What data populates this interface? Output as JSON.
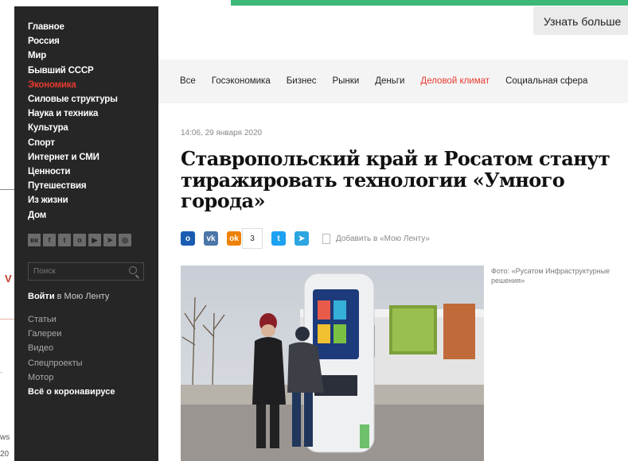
{
  "background_page": {
    "letter": "V",
    "text_bottom_1": "ws",
    "text_bottom_2": "20",
    "dot": "·"
  },
  "learn_more_button": "Узнать больше",
  "sidebar": {
    "nav": [
      {
        "label": "Главное",
        "active": false
      },
      {
        "label": "Россия",
        "active": false
      },
      {
        "label": "Мир",
        "active": false
      },
      {
        "label": "Бывший СССР",
        "active": false
      },
      {
        "label": "Экономика",
        "active": true
      },
      {
        "label": "Силовые структуры",
        "active": false
      },
      {
        "label": "Наука и техника",
        "active": false
      },
      {
        "label": "Культура",
        "active": false
      },
      {
        "label": "Спорт",
        "active": false
      },
      {
        "label": "Интернет и СМИ",
        "active": false
      },
      {
        "label": "Ценности",
        "active": false
      },
      {
        "label": "Путешествия",
        "active": false
      },
      {
        "label": "Из жизни",
        "active": false
      },
      {
        "label": "Дом",
        "active": false
      }
    ],
    "socials": [
      {
        "icon": "vk-icon",
        "glyph": "вк"
      },
      {
        "icon": "facebook-icon",
        "glyph": "f"
      },
      {
        "icon": "twitter-icon",
        "glyph": "t"
      },
      {
        "icon": "odnoklassniki-icon",
        "glyph": "о"
      },
      {
        "icon": "youtube-icon",
        "glyph": "▶"
      },
      {
        "icon": "telegram-icon",
        "glyph": "➤"
      },
      {
        "icon": "instagram-icon",
        "glyph": "◎"
      }
    ],
    "search_placeholder": "Поиск",
    "login_bold": "Войти",
    "login_rest": " в Мою Ленту",
    "sections": [
      {
        "label": "Статьи",
        "strong": false
      },
      {
        "label": "Галереи",
        "strong": false
      },
      {
        "label": "Видео",
        "strong": false
      },
      {
        "label": "Спецпроекты",
        "strong": false
      },
      {
        "label": "Мотор",
        "strong": false
      },
      {
        "label": "Всё о коронавирусе",
        "strong": true
      }
    ]
  },
  "rubrics": [
    {
      "label": "Все",
      "active": false
    },
    {
      "label": "Госэкономика",
      "active": false
    },
    {
      "label": "Бизнес",
      "active": false
    },
    {
      "label": "Рынки",
      "active": false
    },
    {
      "label": "Деньги",
      "active": false
    },
    {
      "label": "Деловой климат",
      "active": true
    },
    {
      "label": "Социальная сфера",
      "active": false
    }
  ],
  "article": {
    "date": "14:06, 29 января 2020",
    "title": "Ставропольский край и Росатом станут тиражировать технологии «Умного города»",
    "share": [
      {
        "icon": "odnoklassniki-round-icon",
        "glyph": "o",
        "color": "#1a5cb1"
      },
      {
        "icon": "vk-share-icon",
        "glyph": "vk",
        "color": "#4a76a8"
      },
      {
        "icon": "ok-share-icon",
        "glyph": "ok",
        "color": "#ee8208"
      }
    ],
    "share_count": "3",
    "share_after": [
      {
        "icon": "twitter-share-icon",
        "glyph": "t",
        "color": "#1da1f2"
      },
      {
        "icon": "telegram-share-icon",
        "glyph": "➤",
        "color": "#2ca5e0"
      }
    ],
    "bookmark_label": "Добавить в «Мою Ленту»",
    "photo_caption": "Фото: «Русатом Инфраструктурные решения»"
  },
  "colors": {
    "accent": "#e63a2e",
    "sidebar_bg": "#262626",
    "top_bar": "#3cb878"
  }
}
